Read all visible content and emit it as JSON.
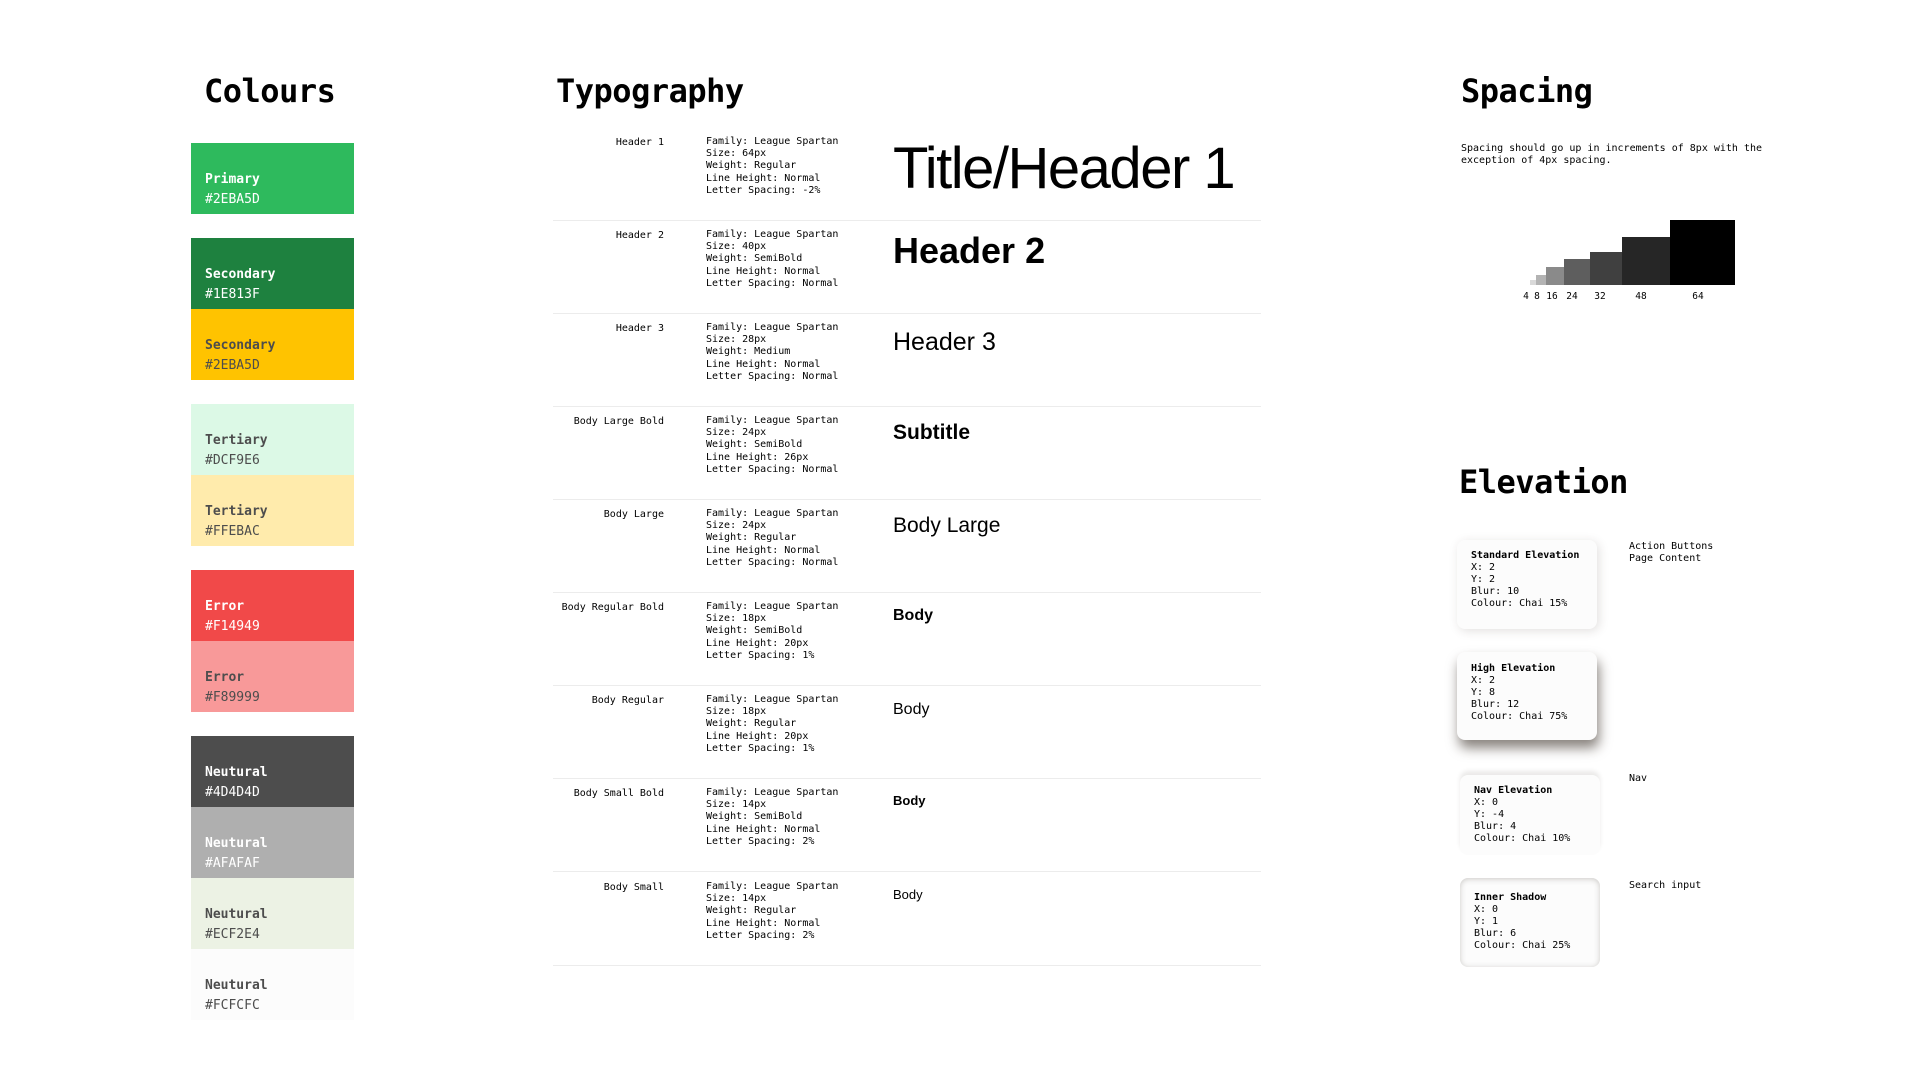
{
  "colours": {
    "title": "Colours",
    "swatches": [
      {
        "name": "Primary",
        "hex": "#2EBA5D",
        "color": "#2EBA5D",
        "text_color": "#FFFFFF"
      },
      {
        "name": "Secondary",
        "hex": "#1E813F",
        "color": "#1E813F",
        "text_color": "#FFFFFF"
      },
      {
        "name": "Secondary",
        "hex": "#2EBA5D",
        "color": "#FFC300",
        "text_color": "#4D4D4D"
      },
      {
        "name": "Tertiary",
        "hex": "#DCF9E6",
        "color": "#DCF9E6",
        "text_color": "#4D4D4D"
      },
      {
        "name": "Tertiary",
        "hex": "#FFEBAC",
        "color": "#FFEBAC",
        "text_color": "#4D4D4D"
      },
      {
        "name": "Error",
        "hex": "#F14949",
        "color": "#F14949",
        "text_color": "#FFFFFF"
      },
      {
        "name": "Error",
        "hex": "#F89999",
        "color": "#F89999",
        "text_color": "#4D4D4D"
      },
      {
        "name": "Neutural",
        "hex": "#4D4D4D",
        "color": "#4D4D4D",
        "text_color": "#FFFFFF"
      },
      {
        "name": "Neutural",
        "hex": "#AFAFAF",
        "color": "#AFAFAF",
        "text_color": "#FFFFFF"
      },
      {
        "name": "Neutural",
        "hex": "#ECF2E4",
        "color": "#ECF2E4",
        "text_color": "#4D4D4D"
      },
      {
        "name": "Neutural",
        "hex": "#FCFCFC",
        "color": "#FCFCFC",
        "text_color": "#4D4D4D"
      }
    ]
  },
  "typography": {
    "title": "Typography",
    "rows": [
      {
        "label": "Header 1",
        "spec": [
          "Family: League Spartan",
          "Size: 64px",
          "Weight: Regular",
          "Line Height: Normal",
          "Letter Spacing: -2%"
        ],
        "sample": "Title/Header 1"
      },
      {
        "label": "Header 2",
        "spec": [
          "Family: League Spartan",
          "Size: 40px",
          "Weight: SemiBold",
          "Line Height: Normal",
          "Letter Spacing: Normal"
        ],
        "sample": "Header 2"
      },
      {
        "label": "Header 3",
        "spec": [
          "Family: League Spartan",
          "Size: 28px",
          "Weight: Medium",
          "Line Height: Normal",
          "Letter Spacing: Normal"
        ],
        "sample": "Header 3"
      },
      {
        "label": "Body Large Bold",
        "spec": [
          "Family: League Spartan",
          "Size: 24px",
          "Weight: SemiBold",
          "Line Height: 26px",
          "Letter Spacing: Normal"
        ],
        "sample": "Subtitle"
      },
      {
        "label": "Body Large",
        "spec": [
          "Family: League Spartan",
          "Size: 24px",
          "Weight: Regular",
          "Line Height: Normal",
          "Letter Spacing: Normal"
        ],
        "sample": "Body Large"
      },
      {
        "label": "Body Regular Bold",
        "spec": [
          "Family: League Spartan",
          "Size: 18px",
          "Weight: SemiBold",
          "Line Height: 20px",
          "Letter Spacing: 1%"
        ],
        "sample": "Body"
      },
      {
        "label": "Body Regular",
        "spec": [
          "Family: League Spartan",
          "Size: 18px",
          "Weight: Regular",
          "Line Height: 20px",
          "Letter Spacing: 1%"
        ],
        "sample": "Body"
      },
      {
        "label": "Body Small Bold",
        "spec": [
          "Family: League Spartan",
          "Size: 14px",
          "Weight: SemiBold",
          "Line Height: Normal",
          "Letter Spacing: 2%"
        ],
        "sample": "Body"
      },
      {
        "label": "Body Small",
        "spec": [
          "Family: League Spartan",
          "Size: 14px",
          "Weight: Regular",
          "Line Height: Normal",
          "Letter Spacing: 2%"
        ],
        "sample": "Body"
      }
    ]
  },
  "spacing": {
    "title": "Spacing",
    "description": "Spacing should go up in increments of 8px with the exception of 4px spacing.",
    "scale": [
      {
        "label": "4",
        "value": 4,
        "color": "#D9D9D9"
      },
      {
        "label": "8",
        "value": 8,
        "color": "#B3B3B3"
      },
      {
        "label": "16",
        "value": 16,
        "color": "#8A8A8A"
      },
      {
        "label": "24",
        "value": 24,
        "color": "#5E5E5E"
      },
      {
        "label": "32",
        "value": 32,
        "color": "#404040"
      },
      {
        "label": "48",
        "value": 48,
        "color": "#262626"
      },
      {
        "label": "64",
        "value": 64,
        "color": "#000000"
      }
    ]
  },
  "elevation": {
    "title": "Elevation",
    "cards": [
      {
        "title": "Standard Elevation",
        "lines": [
          "X: 2",
          "Y: 2",
          "Blur: 10",
          "Colour: Chai 15%"
        ],
        "note": [
          "Action Buttons",
          "Page Content"
        ]
      },
      {
        "title": "High Elevation",
        "lines": [
          "X: 2",
          "Y: 8",
          "Blur: 12",
          "Colour: Chai 75%"
        ],
        "note": []
      },
      {
        "title": "Nav Elevation",
        "lines": [
          "X: 0",
          "Y: -4",
          "Blur: 4",
          "Colour: Chai 10%"
        ],
        "note": [
          "Nav"
        ]
      },
      {
        "title": "Inner Shadow",
        "lines": [
          "X: 0",
          "Y: 1",
          "Blur: 6",
          "Colour: Chai 25%"
        ],
        "note": [
          "Search input"
        ]
      }
    ]
  }
}
